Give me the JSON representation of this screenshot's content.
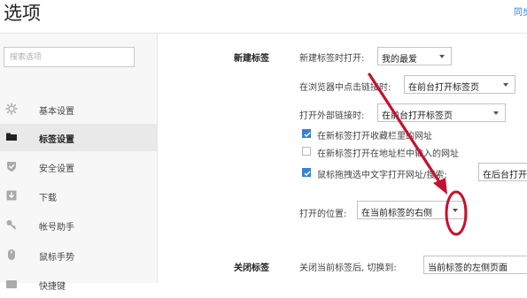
{
  "header": {
    "title": "选项",
    "sync_link": "同步"
  },
  "search": {
    "placeholder": "搜索选项"
  },
  "sidebar": {
    "items": [
      {
        "label": "基本设置",
        "icon": "gear-icon"
      },
      {
        "label": "标签设置",
        "icon": "tab-icon",
        "active": true
      },
      {
        "label": "安全设置",
        "icon": "shield-icon"
      },
      {
        "label": "下载",
        "icon": "download-icon"
      },
      {
        "label": "帐号助手",
        "icon": "key-icon"
      },
      {
        "label": "鼠标手势",
        "icon": "mouse-icon"
      },
      {
        "label": "快捷键",
        "icon": "keyboard-icon"
      }
    ]
  },
  "new_tab": {
    "section_title": "新建标签",
    "open_label": "新建标签时打开:",
    "open_value": "我的最爱",
    "click_link_label": "在浏览器中点击链接时:",
    "click_link_value": "在前台打开标签页",
    "external_link_label": "打开外部链接时:",
    "external_link_value": "在前台打开标签页",
    "checkboxes": [
      {
        "label": "在新标签打开收藏栏里的网址",
        "checked": true
      },
      {
        "label": "在新标签打开在地址栏中输入的网址",
        "checked": false
      },
      {
        "label": "鼠标拖拽选中文字打开网址/搜索:",
        "checked": true
      }
    ],
    "drag_value": "在后台打开",
    "position_label": "打开的位置:",
    "position_value": "在当前标签的右侧"
  },
  "close_tab": {
    "section_title": "关闭标签",
    "after_close_label": "关闭当前标签后, 切换到:",
    "after_close_value": "当前标签的左侧页面"
  },
  "colors": {
    "accent": "#3a7fd5",
    "annotation": "#c8102e"
  }
}
